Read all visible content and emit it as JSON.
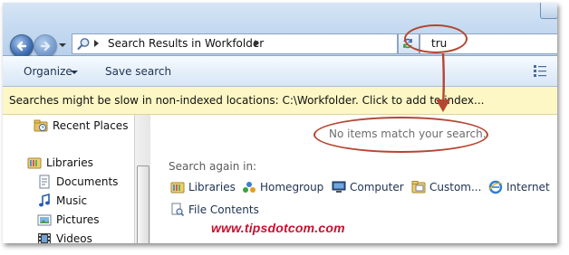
{
  "address_bar": {
    "location": "Search Results in Workfolder"
  },
  "search_box": {
    "value": "tru"
  },
  "toolbar": {
    "organize_label": "Organize",
    "save_search_label": "Save search"
  },
  "info_bar": {
    "text": "Searches might be slow in non-indexed locations: C:\\Workfolder. Click to add to index..."
  },
  "navigation_pane": {
    "items": [
      {
        "label": "Recent Places",
        "icon": "recent-places-icon"
      },
      {
        "label": "Libraries",
        "icon": "libraries-icon"
      },
      {
        "label": "Documents",
        "icon": "documents-icon"
      },
      {
        "label": "Music",
        "icon": "music-icon"
      },
      {
        "label": "Pictures",
        "icon": "pictures-icon"
      },
      {
        "label": "Videos",
        "icon": "videos-icon"
      }
    ]
  },
  "content": {
    "empty_message": "No items match your search.",
    "search_again_label": "Search again in:",
    "search_again_options": [
      {
        "label": "Libraries",
        "icon": "libraries-icon"
      },
      {
        "label": "Homegroup",
        "icon": "homegroup-icon"
      },
      {
        "label": "Computer",
        "icon": "computer-icon"
      },
      {
        "label": "Custom...",
        "icon": "custom-folder-icon"
      },
      {
        "label": "Internet",
        "icon": "internet-explorer-icon"
      }
    ],
    "file_contents_label": "File Contents"
  },
  "watermark": "www.tipsdotcom.com",
  "colors": {
    "annotation": "#b54631",
    "info_bar_bg": "#fcf7c5",
    "watermark": "#c8102e"
  }
}
